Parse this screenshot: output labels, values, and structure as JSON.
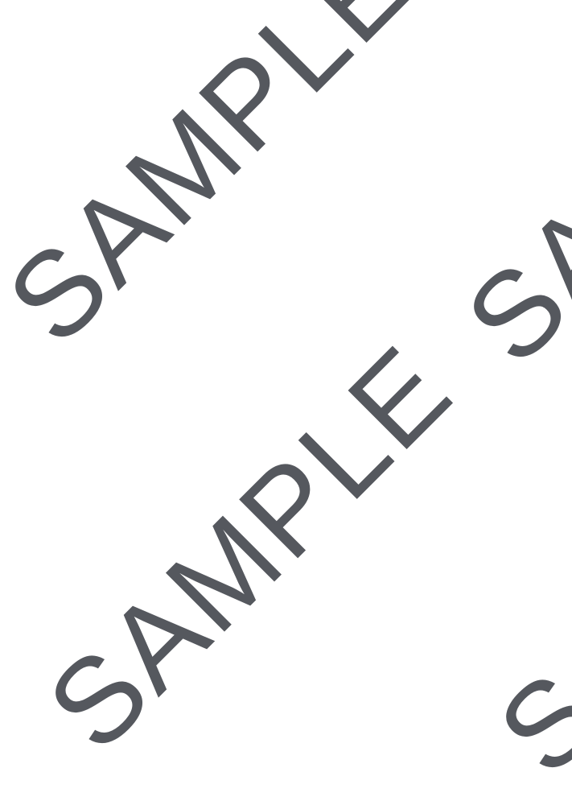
{
  "watermarks": [
    {
      "text": "SAMPLE"
    },
    {
      "text": "SAMPLE"
    },
    {
      "text": "SAMPLE"
    },
    {
      "text": "SAMPLE"
    }
  ],
  "colors": {
    "background": "#ffffff",
    "watermark": "#55585e"
  }
}
